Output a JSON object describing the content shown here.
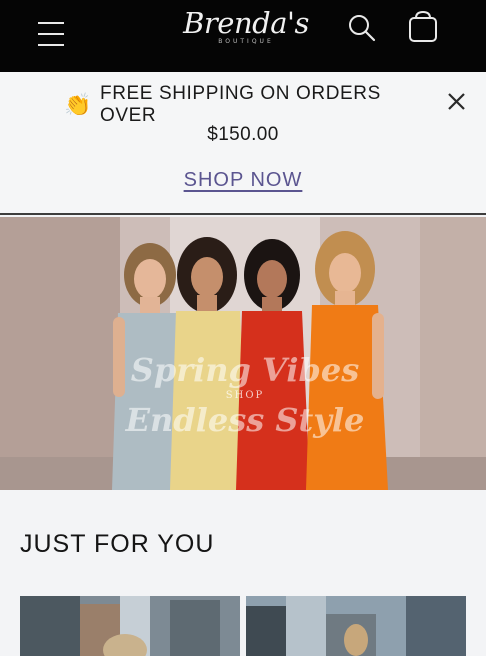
{
  "header": {
    "logo_text": "Brenda's",
    "logo_subtext": "BOUTIQUE",
    "menu_icon": "hamburger-menu-icon",
    "search_icon": "search-icon",
    "cart_icon": "shopping-bag-icon"
  },
  "announcement": {
    "emoji_icon": "clapping-hands-icon",
    "emoji": "👏",
    "line1": "FREE SHIPPING ON ORDERS OVER",
    "line2": "$150.00",
    "link_label": "SHOP NOW",
    "close_icon": "close-icon"
  },
  "hero": {
    "title_line1": "Spring Vibes",
    "shop_label": "SHOP",
    "title_line2": "Endless Style"
  },
  "section": {
    "title": "JUST FOR YOU"
  },
  "colors": {
    "header_bg": "#050505",
    "page_bg": "#f3f4f6",
    "link_color": "#5b5590"
  }
}
